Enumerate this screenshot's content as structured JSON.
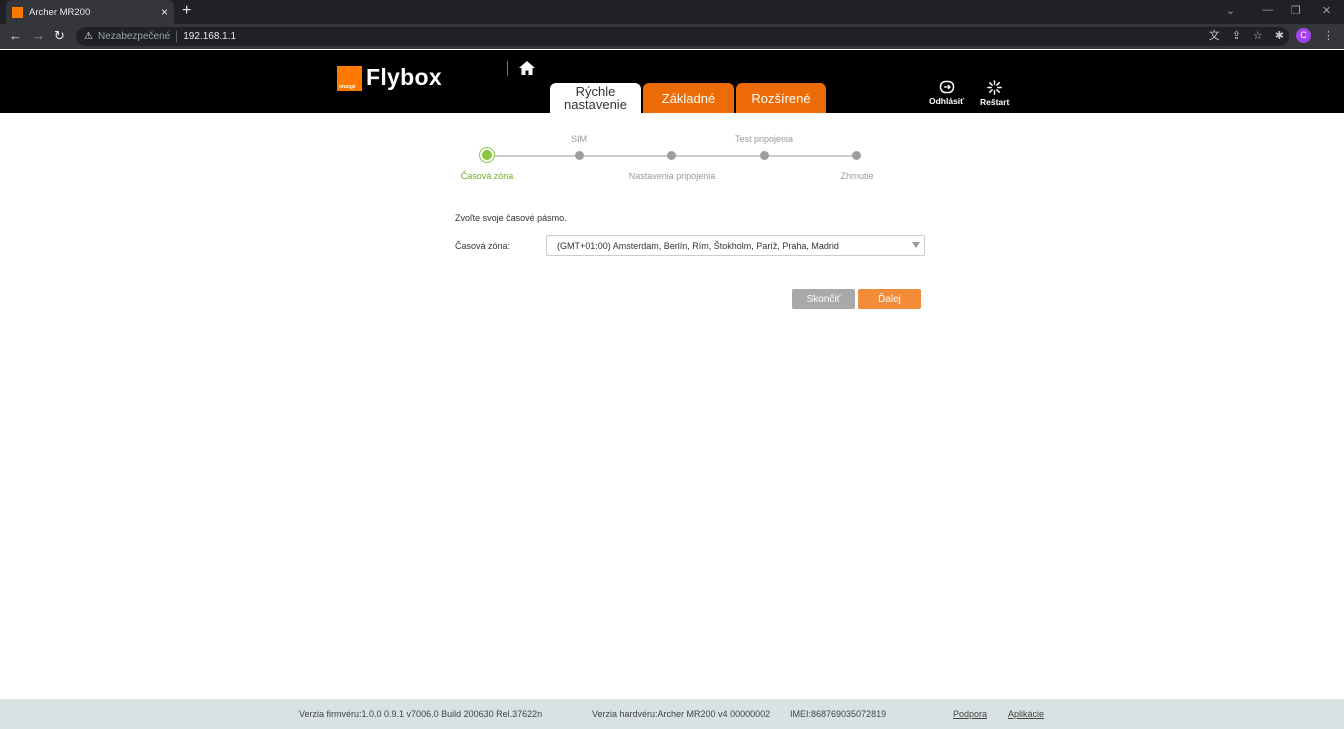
{
  "browser": {
    "tab_title": "Archer MR200",
    "tab_close": "×",
    "new_tab": "+",
    "security_label": "Nezabezpečené",
    "url": "192.168.1.1",
    "profile_initial": "C"
  },
  "header": {
    "brand": "Flybox",
    "logo_text": "orange",
    "tabs": [
      {
        "label_line1": "Rýchle",
        "label_line2": "nastavenie"
      },
      {
        "label": "Základné"
      },
      {
        "label": "Rozšírené"
      }
    ],
    "logout_label": "Odhlásiť",
    "restart_label": "Reštart"
  },
  "wizard": {
    "steps": [
      {
        "label": "Časová zóna",
        "position": "below",
        "state": "active"
      },
      {
        "label": "SIM",
        "position": "above",
        "state": "pending"
      },
      {
        "label": "Nastavenia pripojenia",
        "position": "below",
        "state": "pending"
      },
      {
        "label": "Test pripojenia",
        "position": "above",
        "state": "pending"
      },
      {
        "label": "Zhrnutie",
        "position": "below",
        "state": "pending"
      }
    ],
    "prompt": "Zvoľte svoje časové pásmo.",
    "timezone_label": "Časová zóna:",
    "timezone_value": "(GMT+01:00) Amsterdam, Berlín, Rím, Štokholm, Paríž, Praha, Madrid",
    "skip_label": "Skončiť",
    "next_label": "Ďalej"
  },
  "footer": {
    "firmware": "Verzia firmvéru:1.0.0 0.9.1 v7006.0 Build 200630 Rel.37622n",
    "hardware": "Verzia hardvéru:Archer MR200 v4 00000002",
    "imei": "IMEI:868769035072819",
    "support_link": "Podpora",
    "apps_link": "Aplikácie"
  },
  "colors": {
    "accent_orange": "#ed6b06",
    "step_active": "#8ac640",
    "next_button": "#f28c39"
  }
}
